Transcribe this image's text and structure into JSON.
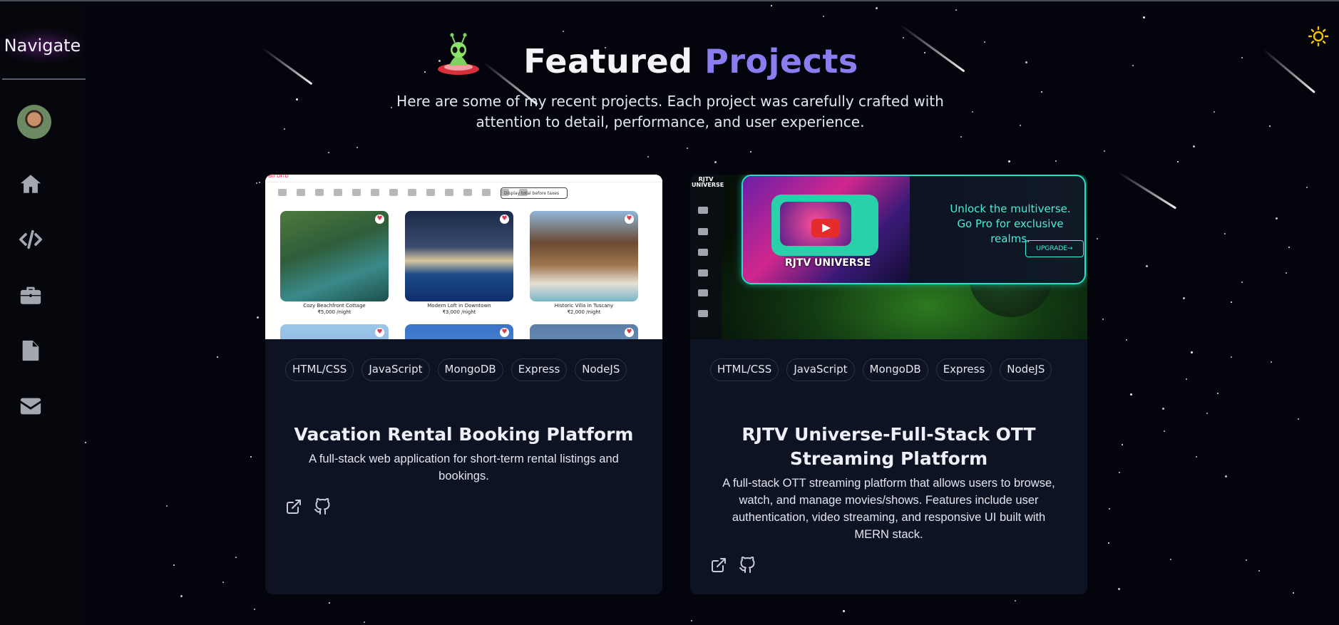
{
  "sidebar": {
    "title": "Navigate",
    "items": [
      {
        "name": "home",
        "icon": "home-icon"
      },
      {
        "name": "skills",
        "icon": "code-icon"
      },
      {
        "name": "experience",
        "icon": "briefcase-icon"
      },
      {
        "name": "resume",
        "icon": "file-icon"
      },
      {
        "name": "contact",
        "icon": "envelope-icon"
      }
    ]
  },
  "header": {
    "title_main": "Featured",
    "title_accent": "Projects",
    "subtitle": "Here are some of my recent projects. Each project was carefully crafted with attention to detail, performance, and user experience."
  },
  "colors": {
    "background": "#03040c",
    "card": "#0e1324",
    "accent": "#8a7df0",
    "sun": "#f5c400"
  },
  "projects": [
    {
      "title": "Vacation Rental Booking Platform",
      "description": "A full-stack web application for short-term rental listings and bookings.",
      "tags": [
        "HTML/CSS",
        "JavaScript",
        "MongoDB",
        "Express",
        "NodeJS"
      ],
      "thumb": {
        "logo": "airbnb",
        "toggle": "Display total before taxes",
        "tiles": [
          {
            "caption": "Cozy Beachfront Cottage",
            "price": "₹5,000 /night"
          },
          {
            "caption": "Modern Loft in Downtown",
            "price": "₹3,000 /night"
          },
          {
            "caption": "Historic Villa in Tuscany",
            "price": "₹2,000 /night"
          }
        ]
      }
    },
    {
      "title": "RJTV Universe-Full-Stack OTT Streaming Platform",
      "description": "A full-stack OTT streaming platform that allows users to browse, watch, and manage movies/shows. Features include user authentication, video streaming, and responsive UI built with MERN stack.",
      "tags": [
        "HTML/CSS",
        "JavaScript",
        "MongoDB",
        "Express",
        "NodeJS"
      ],
      "thumb": {
        "brand": "RJTV UNIVERSE",
        "art_title": "RJTV UNIVERSE",
        "promo": "Unlock the multiverse. Go Pro for exclusive realms.",
        "upgrade": "UPGRADE→"
      }
    }
  ]
}
